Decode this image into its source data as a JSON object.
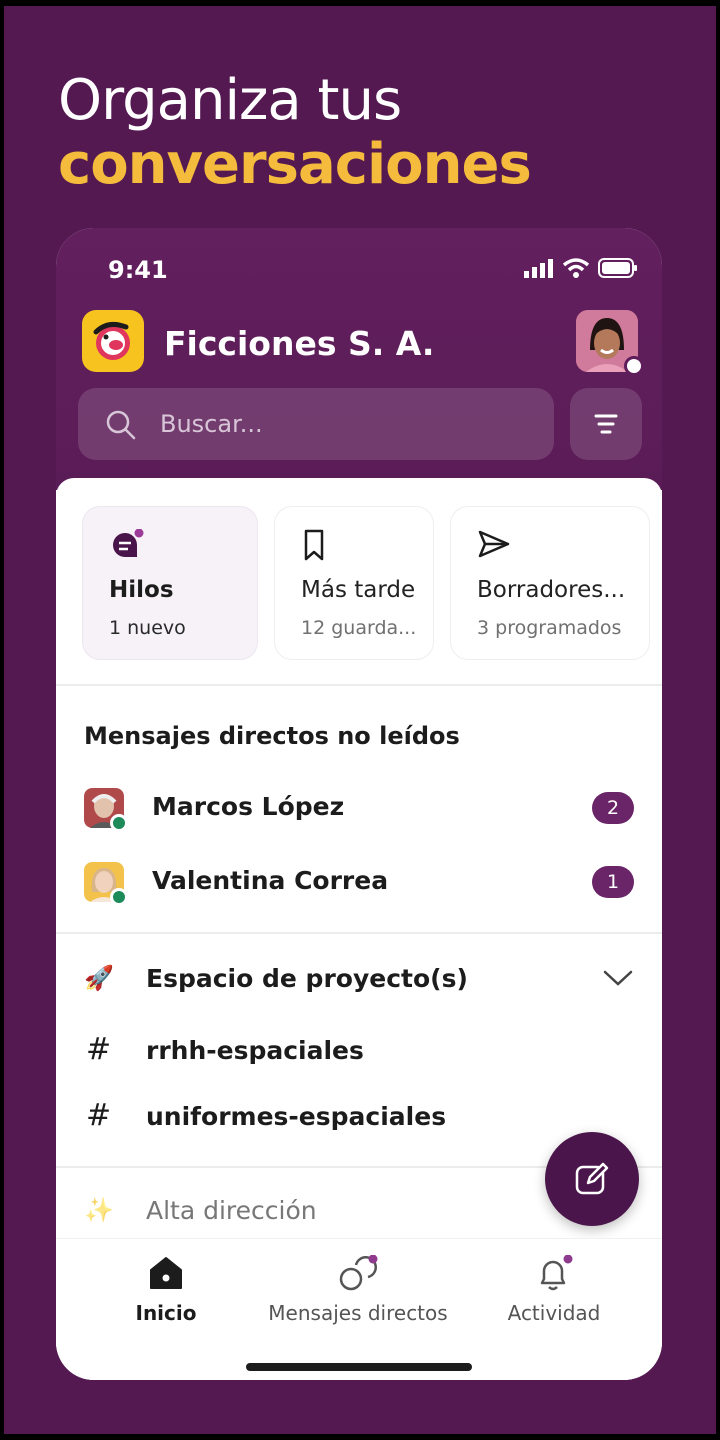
{
  "hero": {
    "line1": "Organiza tus",
    "line2": "conversaciones",
    "line2_color": "#f4bb3c"
  },
  "status_bar": {
    "time": "9:41"
  },
  "header": {
    "workspace_name": "Ficciones S. A.",
    "search_placeholder": "Buscar..."
  },
  "cards": [
    {
      "title": "Hilos",
      "subtitle": "1 nuevo",
      "icon": "threads-icon"
    },
    {
      "title": "Más tarde",
      "subtitle": "12 guarda...",
      "icon": "bookmark-icon"
    },
    {
      "title": "Borradores...",
      "subtitle": "3 programados",
      "icon": "send-icon"
    }
  ],
  "unread_dms": {
    "title": "Mensajes directos no leídos",
    "items": [
      {
        "name": "Marcos López",
        "count": "2"
      },
      {
        "name": "Valentina Correa",
        "count": "1"
      }
    ]
  },
  "sections": [
    {
      "emoji": "🚀",
      "title": "Espacio de proyecto(s)",
      "channels": [
        "rrhh-espaciales",
        "uniformes-espaciales"
      ]
    },
    {
      "emoji": "✨",
      "title": "Alta dirección"
    }
  ],
  "tabbar": {
    "home": "Inicio",
    "dms": "Mensajes directos",
    "activity": "Actividad"
  },
  "colors": {
    "background": "#541951",
    "accent": "#4a154b",
    "badge": "#6a2468",
    "online": "#1d8a5a"
  }
}
